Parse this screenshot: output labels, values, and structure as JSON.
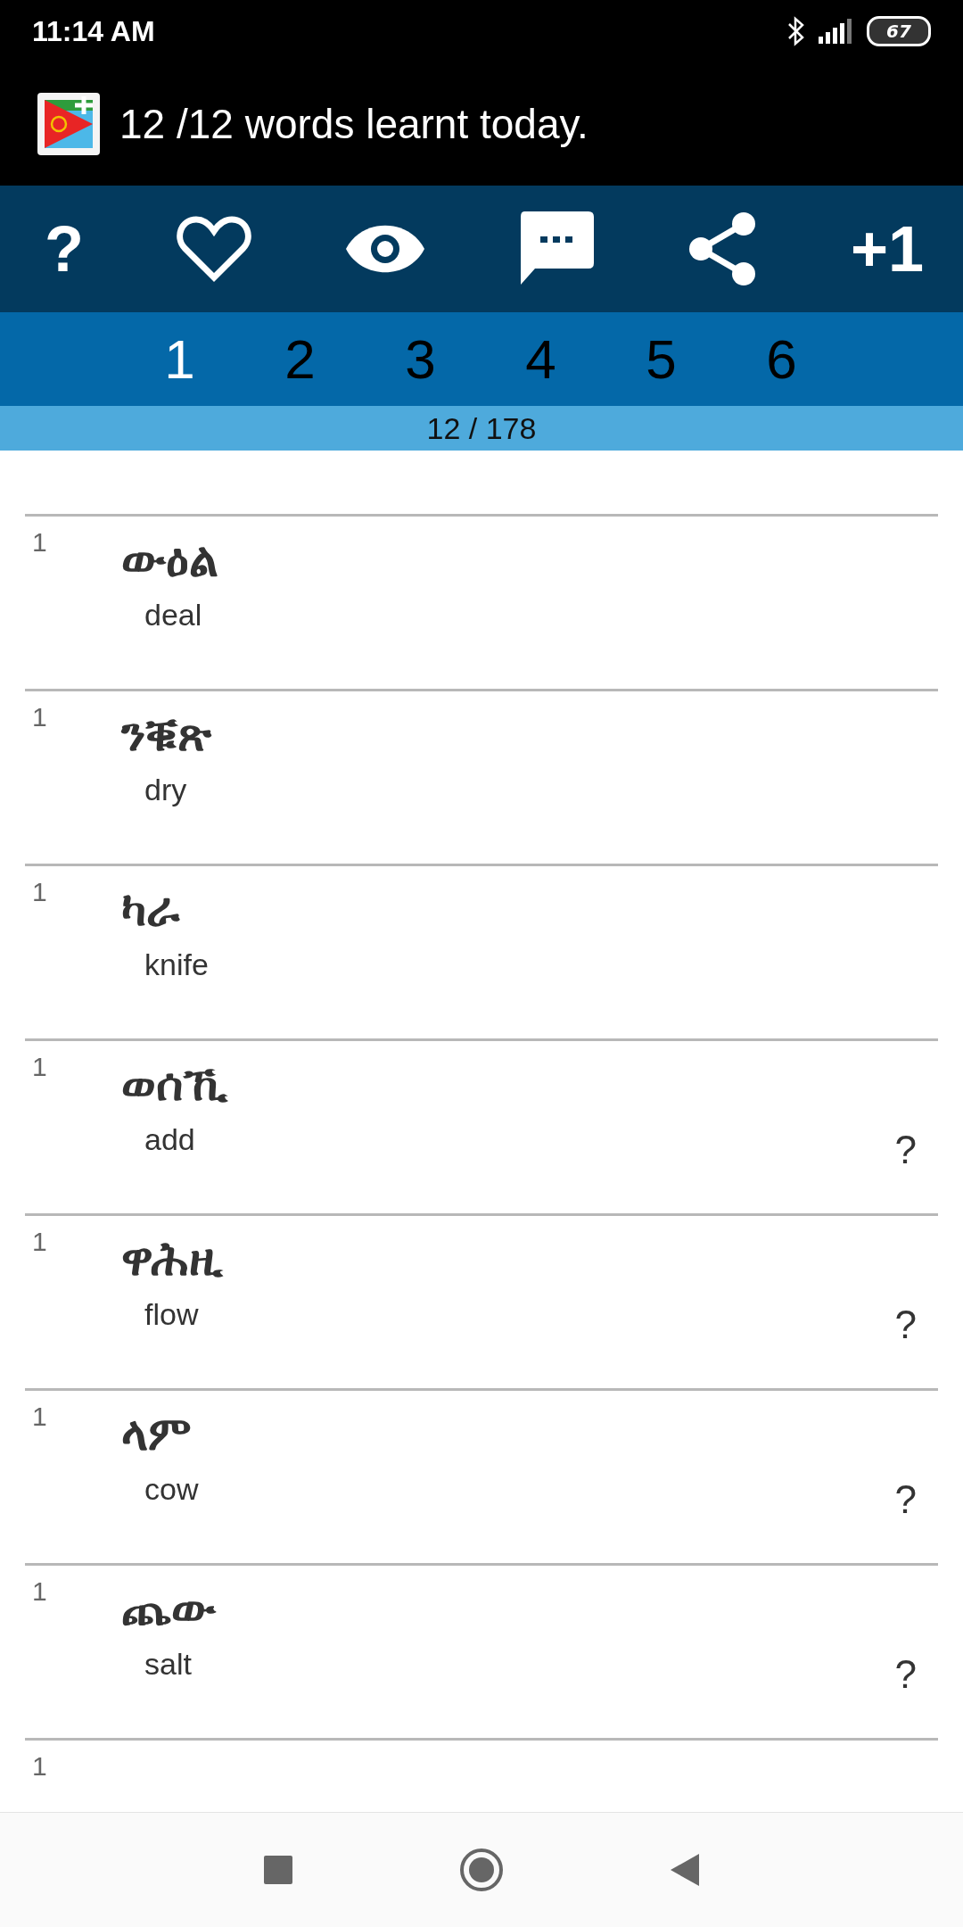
{
  "status_bar": {
    "time": "11:14 AM",
    "battery": "67"
  },
  "header": {
    "title": "12 /12 words learnt today."
  },
  "toolbar": [
    {
      "kind": "text",
      "label": "?"
    },
    {
      "kind": "heart"
    },
    {
      "kind": "eye"
    },
    {
      "kind": "chat"
    },
    {
      "kind": "share"
    },
    {
      "kind": "text",
      "label": "+1"
    }
  ],
  "tabs": [
    {
      "label": "1",
      "selected": true
    },
    {
      "label": "2",
      "selected": false
    },
    {
      "label": "3",
      "selected": false
    },
    {
      "label": "4",
      "selected": false
    },
    {
      "label": "5",
      "selected": false
    },
    {
      "label": "6",
      "selected": false
    }
  ],
  "progress": {
    "label": "12 / 178"
  },
  "words": [
    {
      "count": "1",
      "word": "ውዕል",
      "meaning": "deal"
    },
    {
      "count": "1",
      "word": "ንቑጽ",
      "meaning": "dry"
    },
    {
      "count": "1",
      "word": "ካራ",
      "meaning": "knife"
    },
    {
      "count": "1",
      "word": "ወሰኺ",
      "meaning": "add",
      "flag": "?"
    },
    {
      "count": "1",
      "word": "ዋሕዚ",
      "meaning": "flow",
      "flag": "?"
    },
    {
      "count": "1",
      "word": "ላም",
      "meaning": "cow",
      "flag": "?"
    },
    {
      "count": "1",
      "word": "ጨው",
      "meaning": "salt",
      "flag": "?"
    },
    {
      "count": "1"
    }
  ]
}
